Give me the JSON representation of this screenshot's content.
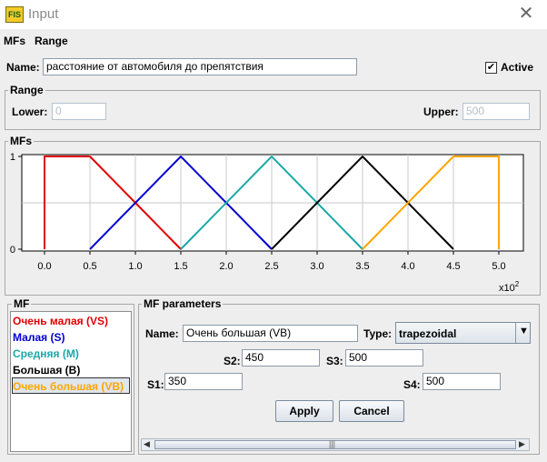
{
  "window": {
    "title": "Input",
    "app_icon_text": "FIS"
  },
  "menu": [
    {
      "label": "MFs"
    },
    {
      "label": "Range"
    }
  ],
  "variable": {
    "name_label": "Name:",
    "name_value": "расстояние от автомобиля до препятствия",
    "active_label": "Active",
    "active_checked": true
  },
  "range": {
    "title": "Range",
    "lower_label": "Lower:",
    "lower_value": "0",
    "upper_label": "Upper:",
    "upper_value": "500"
  },
  "mfs_panel": {
    "title": "MFs"
  },
  "chart_data": {
    "type": "line",
    "xlim": [
      0,
      500
    ],
    "ylim": [
      0,
      1
    ],
    "x_ticks": [
      "0.0",
      "0.5",
      "1.0",
      "1.5",
      "2.0",
      "2.5",
      "3.0",
      "3.5",
      "4.0",
      "4.5",
      "5.0"
    ],
    "y_ticks": [
      "0",
      "1"
    ],
    "x_multiplier": "x10",
    "x_multiplier_exp": "2",
    "grid": true,
    "series": [
      {
        "name": "Очень малая (VS)",
        "color": "#e00000",
        "x": [
          0,
          0,
          50,
          150
        ],
        "y": [
          0,
          1,
          1,
          0
        ]
      },
      {
        "name": "Малая (S)",
        "color": "#0000d0",
        "x": [
          50,
          150,
          250
        ],
        "y": [
          0,
          1,
          0
        ]
      },
      {
        "name": "Средняя (M)",
        "color": "#1aa8a8",
        "x": [
          150,
          250,
          350
        ],
        "y": [
          0,
          1,
          0
        ]
      },
      {
        "name": "Большая (B)",
        "color": "#000000",
        "x": [
          250,
          350,
          450
        ],
        "y": [
          0,
          1,
          0
        ]
      },
      {
        "name": "Очень большая (VB)",
        "color": "#ffa500",
        "x": [
          350,
          450,
          500,
          500
        ],
        "y": [
          0,
          1,
          1,
          0
        ]
      }
    ]
  },
  "mf_list": {
    "title": "MF",
    "items": [
      {
        "label": "Очень малая (VS)",
        "color": "#e00000"
      },
      {
        "label": "Малая (S)",
        "color": "#0000d0"
      },
      {
        "label": "Средняя (M)",
        "color": "#1aa8a8"
      },
      {
        "label": "Большая (B)",
        "color": "#000000"
      },
      {
        "label": "Очень большая (VB)",
        "color": "#ffa500",
        "selected": true
      }
    ]
  },
  "mf_params": {
    "title": "MF parameters",
    "name_label": "Name:",
    "name_value": "Очень большая (VB)",
    "type_label": "Type:",
    "type_value": "trapezoidal",
    "s1_label": "S1:",
    "s1_value": "350",
    "s2_label": "S2:",
    "s2_value": "450",
    "s3_label": "S3:",
    "s3_value": "500",
    "s4_label": "S4:",
    "s4_value": "500",
    "apply_label": "Apply",
    "cancel_label": "Cancel",
    "scroll_grip": "|||"
  }
}
